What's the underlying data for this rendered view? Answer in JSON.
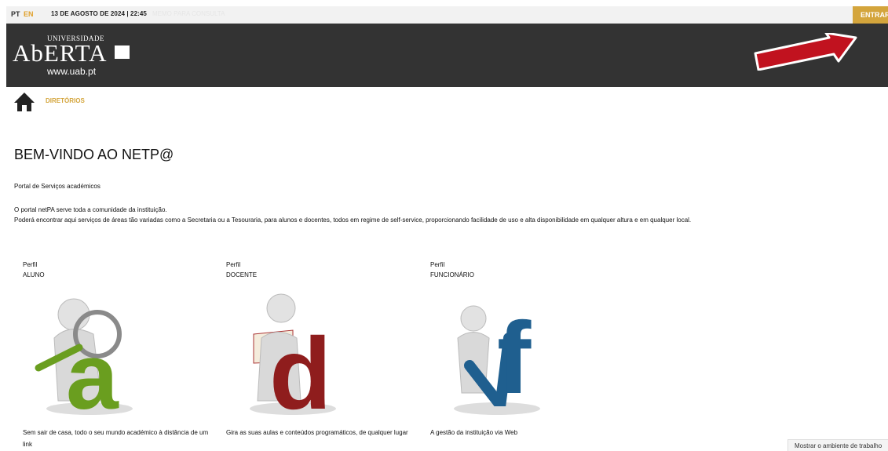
{
  "topbar": {
    "lang_pt": "PT",
    "lang_en": "EN",
    "datetime": "13 DE AGOSTO DE 2024 | 22:45",
    "faded_text": "MEMO PARA CONSULTA",
    "login_label": "ENTRAR"
  },
  "header": {
    "logo_small": "UNIVERSIDADE",
    "logo_main": "AbERTA",
    "logo_url": "www.uab.pt"
  },
  "nav": {
    "breadcrumb": "DIRETÓRIOS"
  },
  "main": {
    "title": "BEM-VINDO AO NETP@",
    "subtitle": "Portal de Serviços académicos",
    "desc_line1": "O portal netPA serve toda a comunidade da instituição.",
    "desc_line2": "Poderá encontrar aqui serviços de áreas tão variadas como a Secretaria ou a Tesouraria, para alunos e docentes, todos em regime de self-service, proporcionando facilidade de uso e alta disponibilidade em qualquer altura e em qualquer local."
  },
  "profiles": [
    {
      "label": "Perfil",
      "name": "ALUNO",
      "letter": "a",
      "desc": "Sem sair de casa, todo o seu mundo académico à distância de um link"
    },
    {
      "label": "Perfil",
      "name": "DOCENTE",
      "letter": "d",
      "desc": "Gira as suas aulas e conteúdos programáticos, de qualquer lugar"
    },
    {
      "label": "Perfil",
      "name": "FUNCIONÁRIO",
      "letter": "f",
      "desc": "A gestão da instituição via Web"
    }
  ],
  "tooltip": {
    "text": "Mostrar o ambiente de trabalho"
  },
  "colors": {
    "accent": "#d4a53c",
    "header_bg": "#333333",
    "aluno": "#6a9e1f",
    "docente": "#8f1d1d",
    "funcionario": "#1f5f8f",
    "arrow": "#c1121f"
  }
}
